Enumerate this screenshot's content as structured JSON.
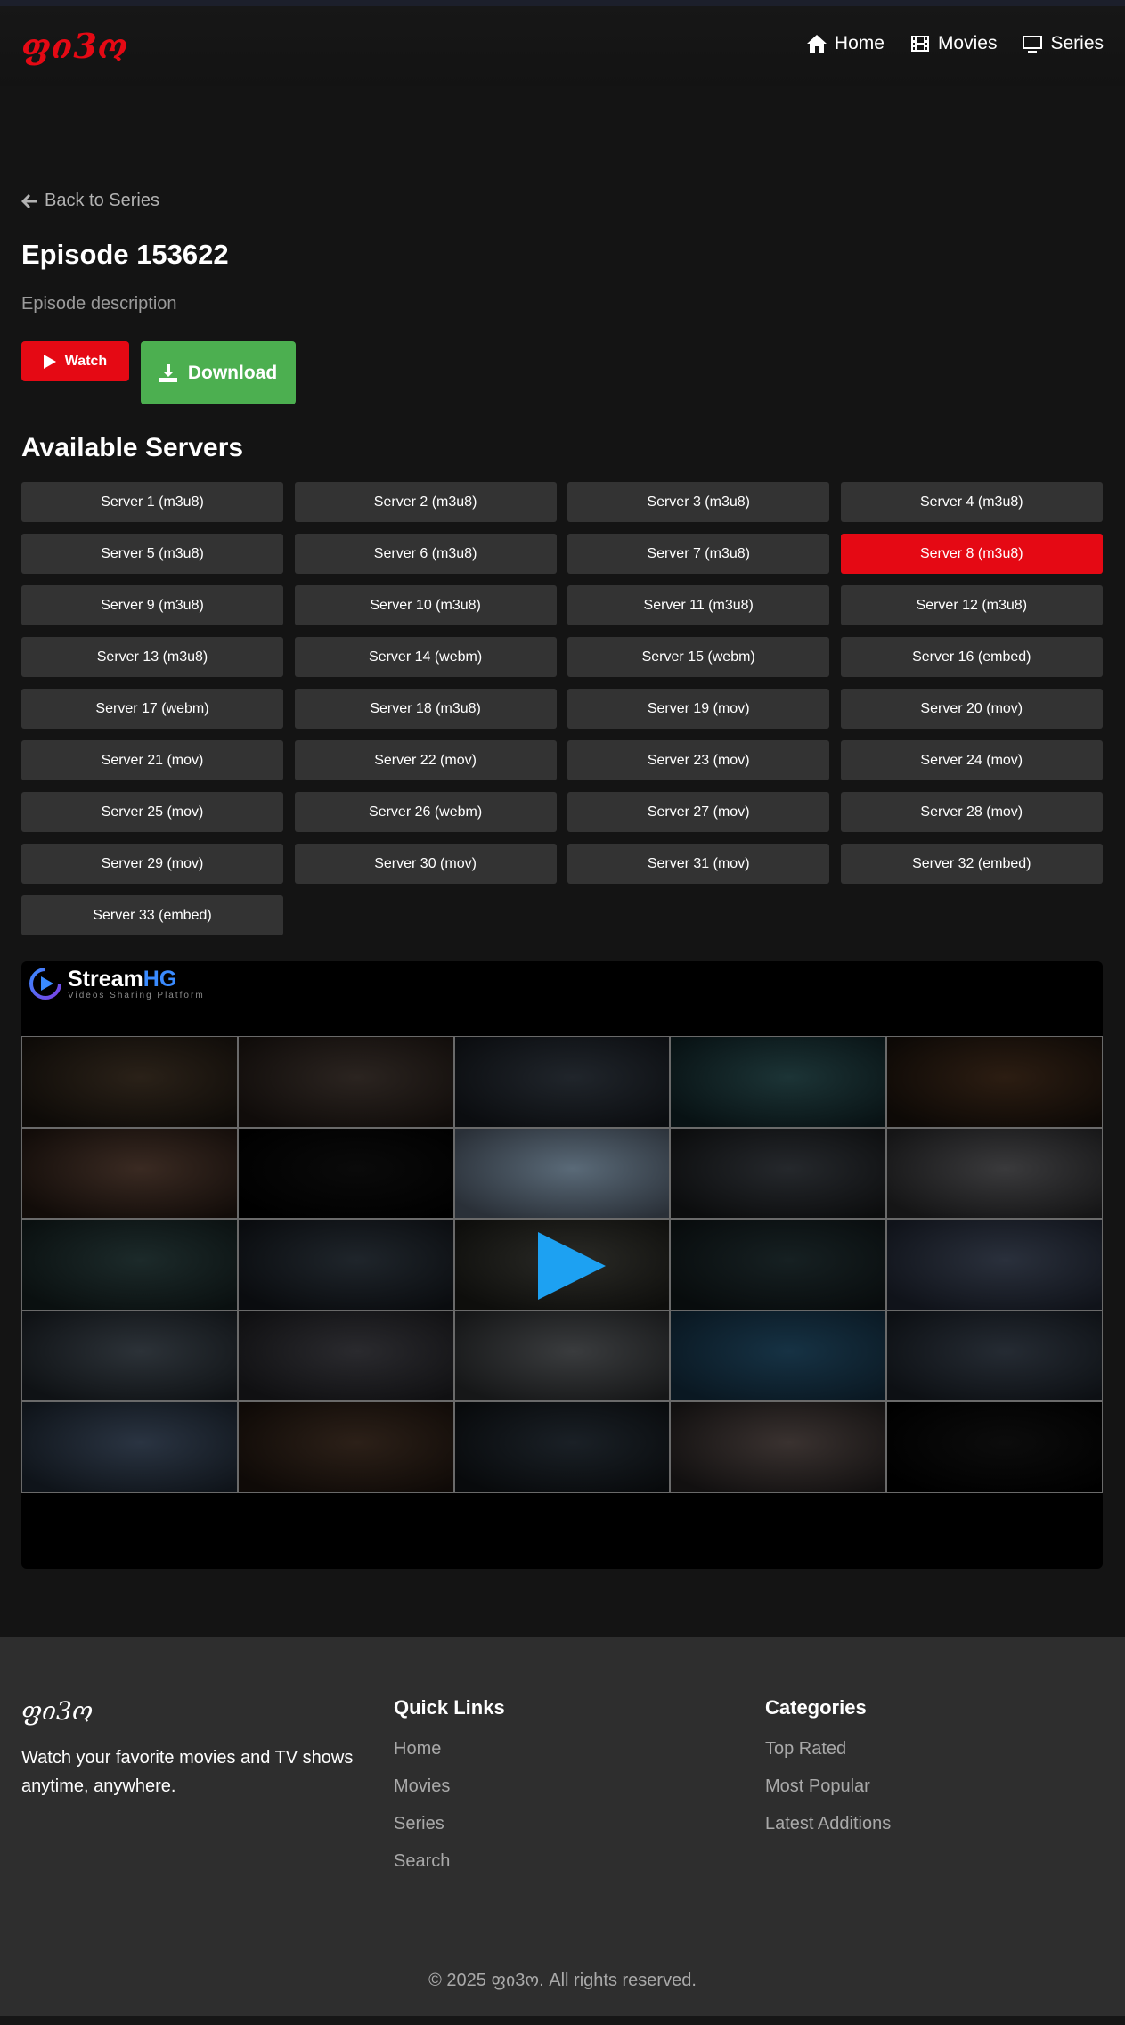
{
  "header": {
    "logo": "ფი3ო",
    "nav": [
      {
        "label": "Home",
        "icon": "home-icon"
      },
      {
        "label": "Movies",
        "icon": "film-icon"
      },
      {
        "label": "Series",
        "icon": "tv-icon"
      }
    ]
  },
  "episode": {
    "back_label": "Back to Series",
    "title": "Episode 153622",
    "description": "Episode description",
    "watch_label": "Watch",
    "download_label": "Download"
  },
  "servers": {
    "title": "Available Servers",
    "active_index": 7,
    "items": [
      "Server 1 (m3u8)",
      "Server 2 (m3u8)",
      "Server 3 (m3u8)",
      "Server 4 (m3u8)",
      "Server 5 (m3u8)",
      "Server 6 (m3u8)",
      "Server 7 (m3u8)",
      "Server 8 (m3u8)",
      "Server 9 (m3u8)",
      "Server 10 (m3u8)",
      "Server 11 (m3u8)",
      "Server 12 (m3u8)",
      "Server 13 (m3u8)",
      "Server 14 (webm)",
      "Server 15 (webm)",
      "Server 16 (embed)",
      "Server 17 (webm)",
      "Server 18 (m3u8)",
      "Server 19 (mov)",
      "Server 20 (mov)",
      "Server 21 (mov)",
      "Server 22 (mov)",
      "Server 23 (mov)",
      "Server 24 (mov)",
      "Server 25 (mov)",
      "Server 26 (webm)",
      "Server 27 (mov)",
      "Server 28 (mov)",
      "Server 29 (mov)",
      "Server 30 (mov)",
      "Server 31 (mov)",
      "Server 32 (embed)",
      "Server 33 (embed)"
    ]
  },
  "player": {
    "brand_main": "Stream",
    "brand_accent": "HG",
    "brand_sub": "Videos Sharing Platform",
    "thumb_count": 25
  },
  "footer": {
    "logo": "ფი3ო",
    "tagline": "Watch your favorite movies and TV shows anytime, anywhere.",
    "quick_links_title": "Quick Links",
    "quick_links": [
      "Home",
      "Movies",
      "Series",
      "Search"
    ],
    "categories_title": "Categories",
    "categories": [
      "Top Rated",
      "Most Popular",
      "Latest Additions"
    ],
    "copyright": "© 2025 ფი3ო. All rights reserved."
  },
  "colors": {
    "accent": "#e50914",
    "download": "#4caf50",
    "server_bg": "#333333",
    "page_bg": "#141414",
    "footer_bg": "#2e2e2e",
    "play": "#1da1f2"
  }
}
